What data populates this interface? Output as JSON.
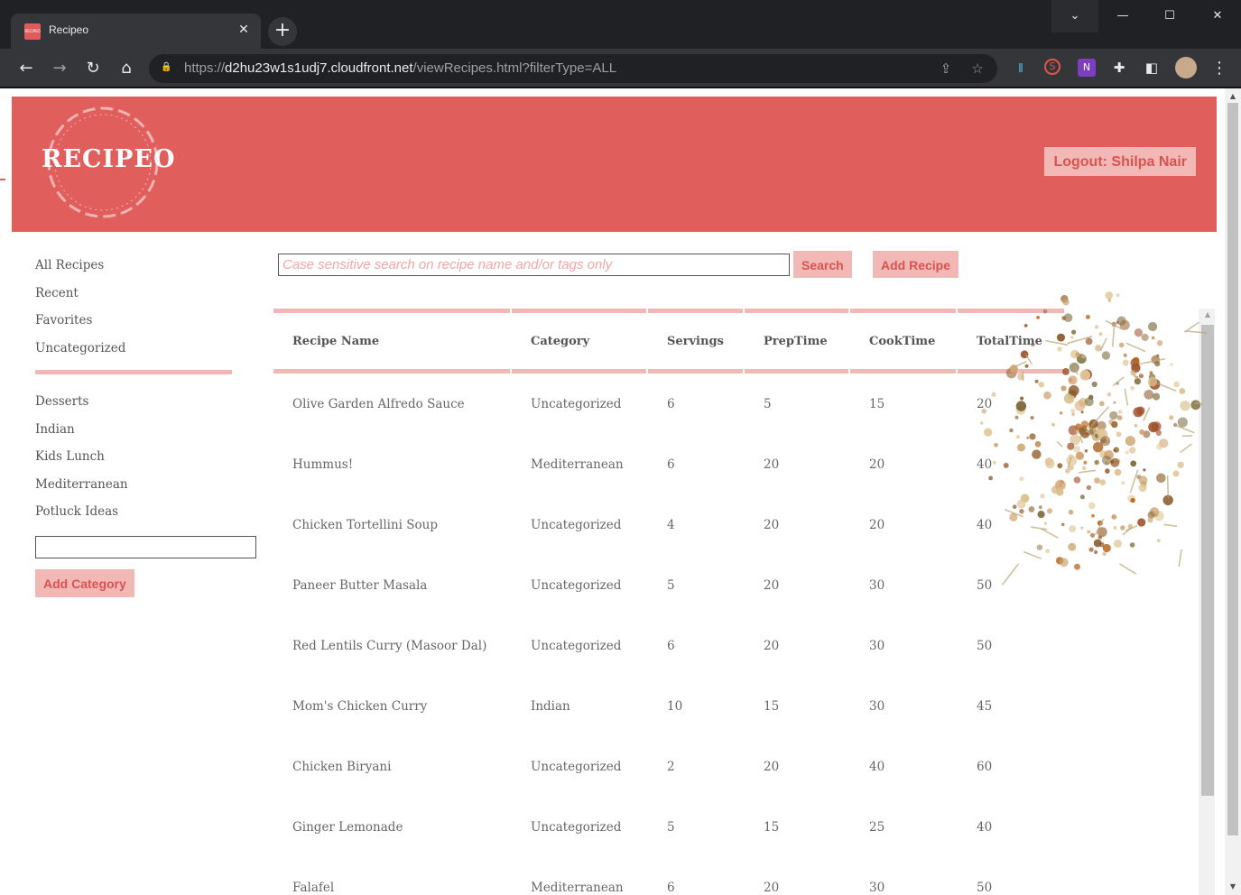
{
  "browser": {
    "tab_title": "Recipeo",
    "tab_favicon_text": "RECIPEO",
    "url_scheme": "https://",
    "url_host": "d2hu23w1s1udj7.cloudfront.net",
    "url_path": "/viewRecipes.html?filterType=ALL"
  },
  "header": {
    "logo_text": "RECIPEO",
    "logout_label": "Logout: Shilpa Nair",
    "background_color": "#e05e5c",
    "button_color": "#f2b8b6"
  },
  "sidebar": {
    "filters": [
      "All Recipes",
      "Recent",
      "Favorites",
      "Uncategorized"
    ],
    "categories": [
      "Desserts",
      "Indian",
      "Kids Lunch",
      "Mediterranean",
      "Potluck Ideas"
    ],
    "category_input_value": "",
    "add_category_label": "Add Category"
  },
  "search": {
    "placeholder": "Case sensitive search on recipe name and/or tags only",
    "value": "",
    "search_label": "Search",
    "add_recipe_label": "Add Recipe"
  },
  "table": {
    "columns": [
      "Recipe Name",
      "Category",
      "Servings",
      "PrepTime",
      "CookTime",
      "TotalTime"
    ],
    "rows": [
      [
        "Olive Garden Alfredo Sauce",
        "Uncategorized",
        "6",
        "5",
        "15",
        "20"
      ],
      [
        "Hummus!",
        "Mediterranean",
        "6",
        "20",
        "20",
        "40"
      ],
      [
        "Chicken Tortellini Soup",
        "Uncategorized",
        "4",
        "20",
        "20",
        "40"
      ],
      [
        "Paneer Butter Masala",
        "Uncategorized",
        "5",
        "20",
        "30",
        "50"
      ],
      [
        "Red Lentils Curry (Masoor Dal)",
        "Uncategorized",
        "6",
        "20",
        "30",
        "50"
      ],
      [
        "Mom's Chicken Curry",
        "Indian",
        "10",
        "15",
        "30",
        "45"
      ],
      [
        "Chicken Biryani",
        "Uncategorized",
        "2",
        "20",
        "40",
        "60"
      ],
      [
        "Ginger Lemonade",
        "Uncategorized",
        "5",
        "15",
        "25",
        "40"
      ],
      [
        "Falafel",
        "Mediterranean",
        "6",
        "20",
        "30",
        "50"
      ]
    ]
  }
}
